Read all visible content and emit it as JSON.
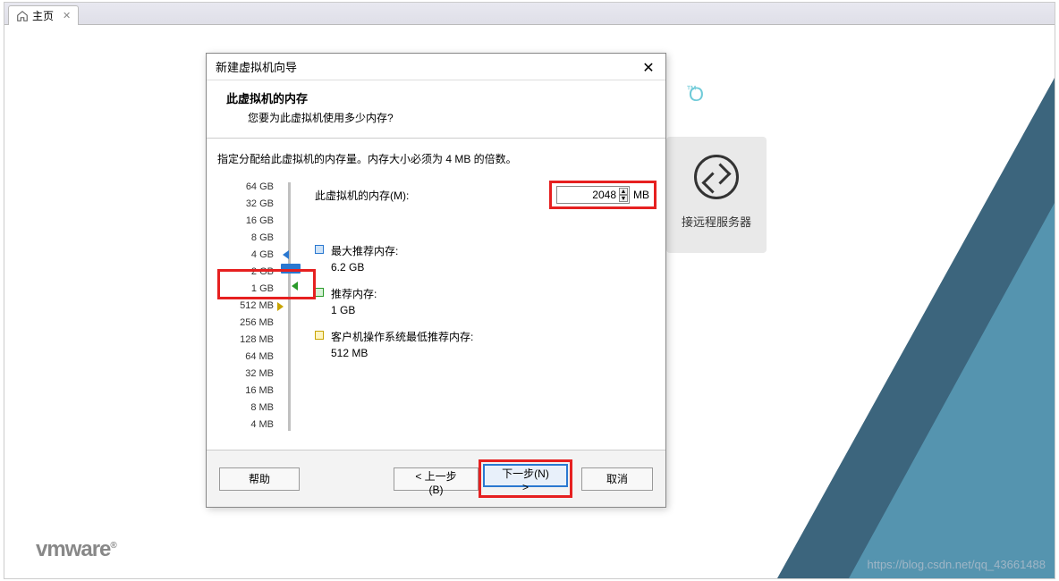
{
  "tab": {
    "label": "主页"
  },
  "background": {
    "pro_text": "O",
    "tm": "™",
    "remote_label": "接远程服务器",
    "vmware": "vmware",
    "watermark": "https://blog.csdn.net/qq_43661488"
  },
  "dialog": {
    "title": "新建虚拟机向导",
    "heading": "此虚拟机的内存",
    "subheading": "您要为此虚拟机使用多少内存?",
    "instruction": "指定分配给此虚拟机的内存量。内存大小必须为 4 MB 的倍数。",
    "mem_label": "此虚拟机的内存(M):",
    "mem_value": "2048",
    "mem_unit": "MB",
    "scale": [
      "64 GB",
      "32 GB",
      "16 GB",
      "8 GB",
      "4 GB",
      "2 GB",
      "1 GB",
      "512 MB",
      "256 MB",
      "128 MB",
      "64 MB",
      "32 MB",
      "16 MB",
      "8 MB",
      "4 MB"
    ],
    "rec_max_label": "最大推荐内存:",
    "rec_max_value": "6.2 GB",
    "rec_label": "推荐内存:",
    "rec_value": "1 GB",
    "rec_min_label": "客户机操作系统最低推荐内存:",
    "rec_min_value": "512 MB",
    "footer": {
      "help": "帮助",
      "back": "< 上一步(B)",
      "next": "下一步(N) >",
      "cancel": "取消"
    }
  }
}
